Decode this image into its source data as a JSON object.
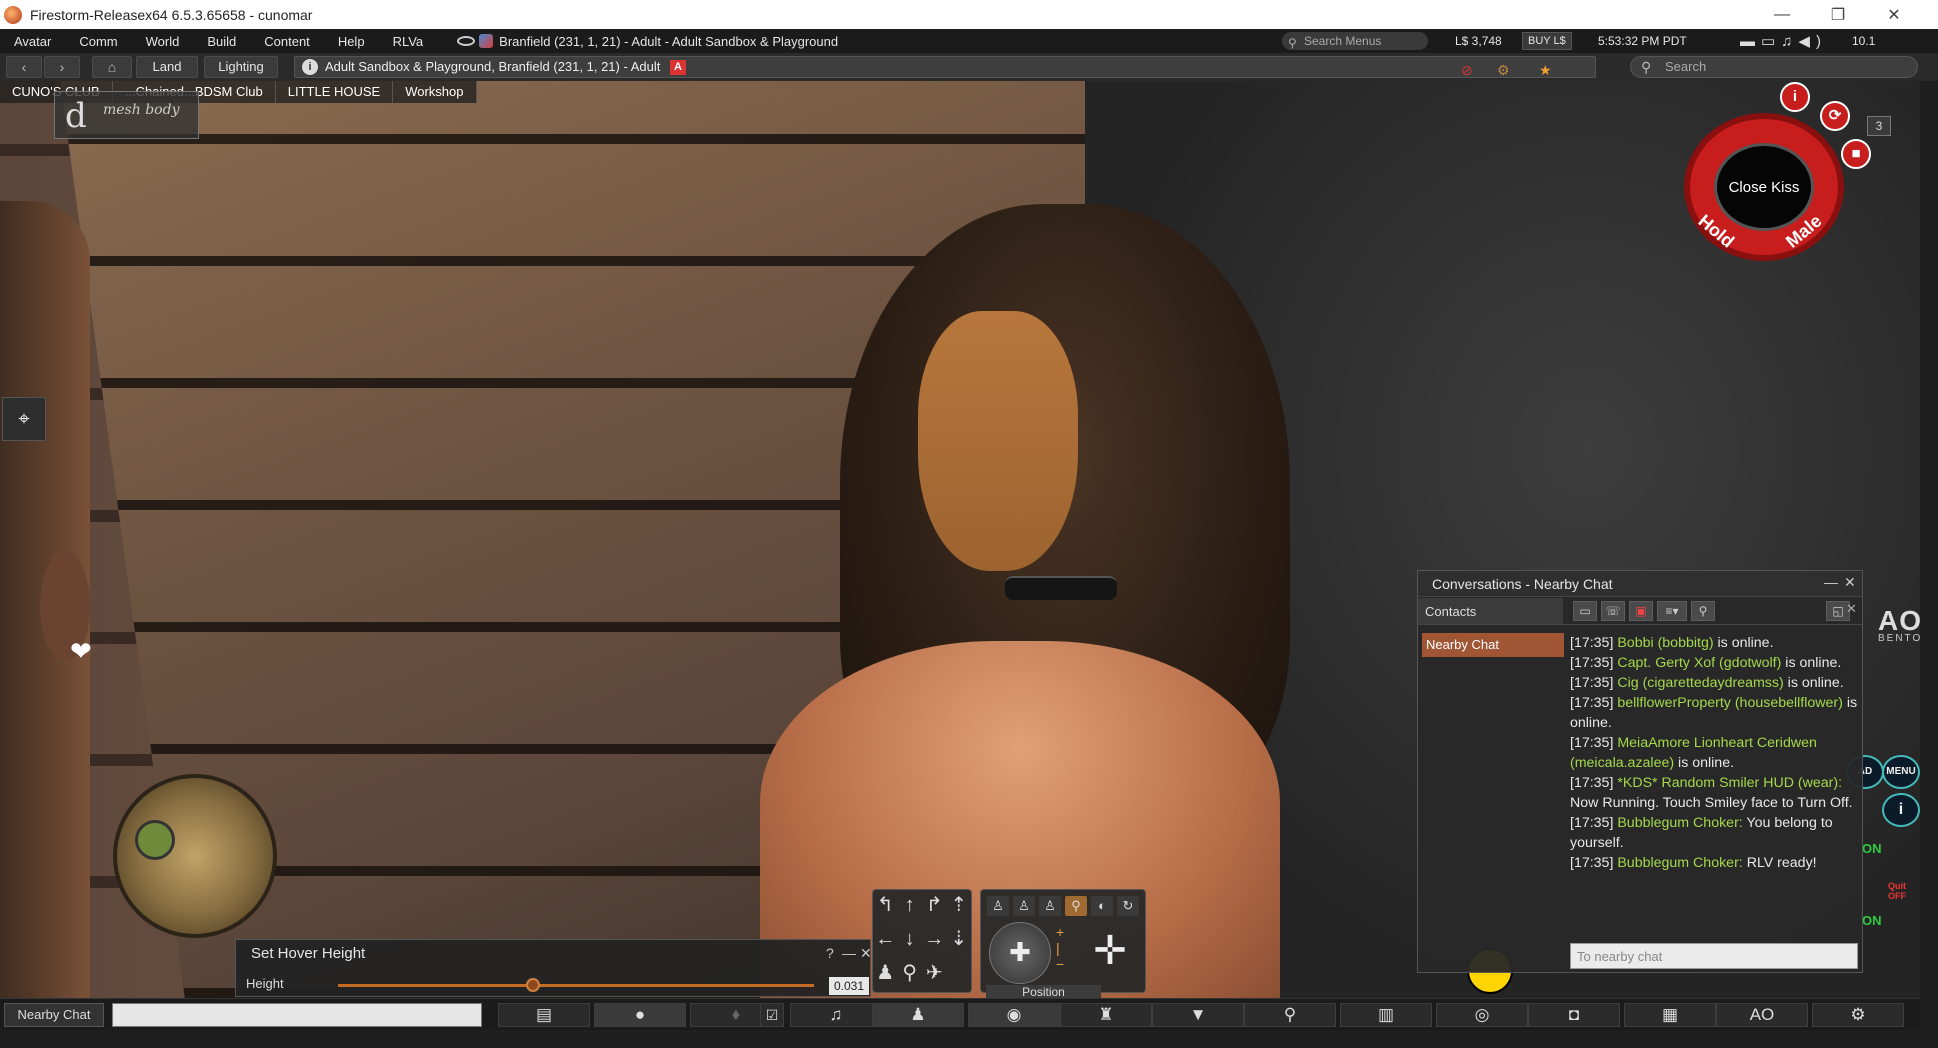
{
  "window": {
    "title": "Firestorm-Releasex64 6.5.3.65658 - cunomar",
    "minimize": "—",
    "maximize": "❐",
    "close": "✕"
  },
  "menubar": {
    "items": [
      "Avatar",
      "Comm",
      "World",
      "Build",
      "Content",
      "Help",
      "RLVa"
    ],
    "parcel": "Branfield (231, 1, 21) - Adult - Adult Sandbox & Playground",
    "search_placeholder": "Search Menus",
    "balance": "L$ 3,748",
    "buy_label": "BUY L$",
    "time": "5:53:32 PM PDT",
    "version": "10.1",
    "media_icons": "▬▭♫◀)"
  },
  "navbar": {
    "land_label": "Land",
    "lighting_label": "Lighting",
    "location": "Adult Sandbox & Playground, Branfield (231, 1, 21) - Adult",
    "adult_badge": "A",
    "search_placeholder": "Search"
  },
  "favorites": [
    "CUNO'S CLUB",
    "...Chained...BDSM Club",
    "LITTLE HOUSE",
    "Workshop"
  ],
  "hud": {
    "mesh_logo": "mesh body",
    "mesh_logo_mark": "d",
    "animation_label": "Close Kiss",
    "hold_label": "Hold",
    "male_label": "Male",
    "counter": "3",
    "info_dot": "i",
    "refresh_dot": "⟳",
    "stop_dot": "■",
    "ao_logo": "AO",
    "ao_sub": "BENTO",
    "ao_menu": "MENU",
    "ao_on_1": "ON",
    "ao_on_2": "ON",
    "ao_ad": "AD",
    "ao_quit": "Quit OFF",
    "ao_info": "i"
  },
  "conversations": {
    "title": "Conversations - Nearby Chat",
    "contacts_label": "Contacts",
    "nearby_tab": "Nearby Chat",
    "input_placeholder": "To nearby chat",
    "messages": [
      {
        "time": "[17:35]",
        "who": "Bobbi (bobbitg)",
        "text": " is online."
      },
      {
        "time": "[17:35]",
        "who": "Capt. Gerty Xof (gdotwolf)",
        "text": " is online."
      },
      {
        "time": "[17:35]",
        "who": "Cig (cigarettedaydreamss)",
        "text": " is online."
      },
      {
        "time": "[17:35]",
        "who": "bellflowerProperty (housebellflower)",
        "text": " is online."
      },
      {
        "time": "[17:35]",
        "who": "MeiaAmore Lionheart Ceridwen (meicala.azalee)",
        "text": " is online."
      },
      {
        "time": "[17:35]",
        "who": "*KDS* Random Smiler HUD (wear):",
        "text": " Now Running. Touch Smiley face to Turn Off."
      },
      {
        "time": "[17:35]",
        "who": "Bubblegum Choker:",
        "text": " You belong to yourself."
      },
      {
        "time": "[17:35]",
        "who": "Bubblegum Choker:",
        "text": " RLV ready!"
      }
    ]
  },
  "hover_height": {
    "title": "Set Hover Height",
    "help": "?",
    "minimize": "—",
    "close": "✕",
    "label": "Height",
    "value": "0.031",
    "slider_fraction": 0.41
  },
  "camera": {
    "position_label": "Position"
  },
  "bottombar": {
    "nearby_chat": "Nearby Chat",
    "ao_label": "AO"
  }
}
